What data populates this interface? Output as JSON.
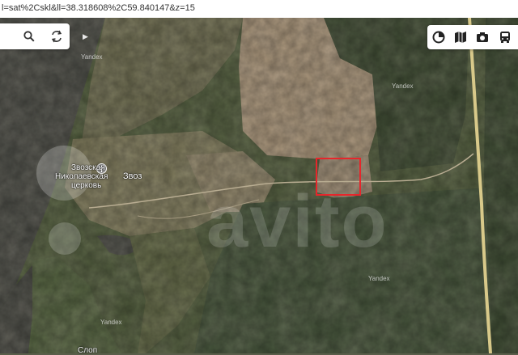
{
  "browser": {
    "url_fragment": "l=sat%2Cskl&ll=38.318608%2C59.840147&z=15"
  },
  "map": {
    "watermark": "Yandex",
    "labels": {
      "village_name": "Звоз",
      "church_line1": "Звозская",
      "church_line2": "Николаевская",
      "church_line3": "церковь",
      "bottom_cut": "Слоп"
    },
    "overlay_watermark": "avito",
    "plot_color": "#e6262b"
  },
  "search_panel": {
    "search_icon": "search-icon",
    "route_icon": "route-icon"
  },
  "toolbar": {
    "icons": [
      "layers-icon",
      "map-mode-icon",
      "camera-icon",
      "transport-icon"
    ]
  }
}
